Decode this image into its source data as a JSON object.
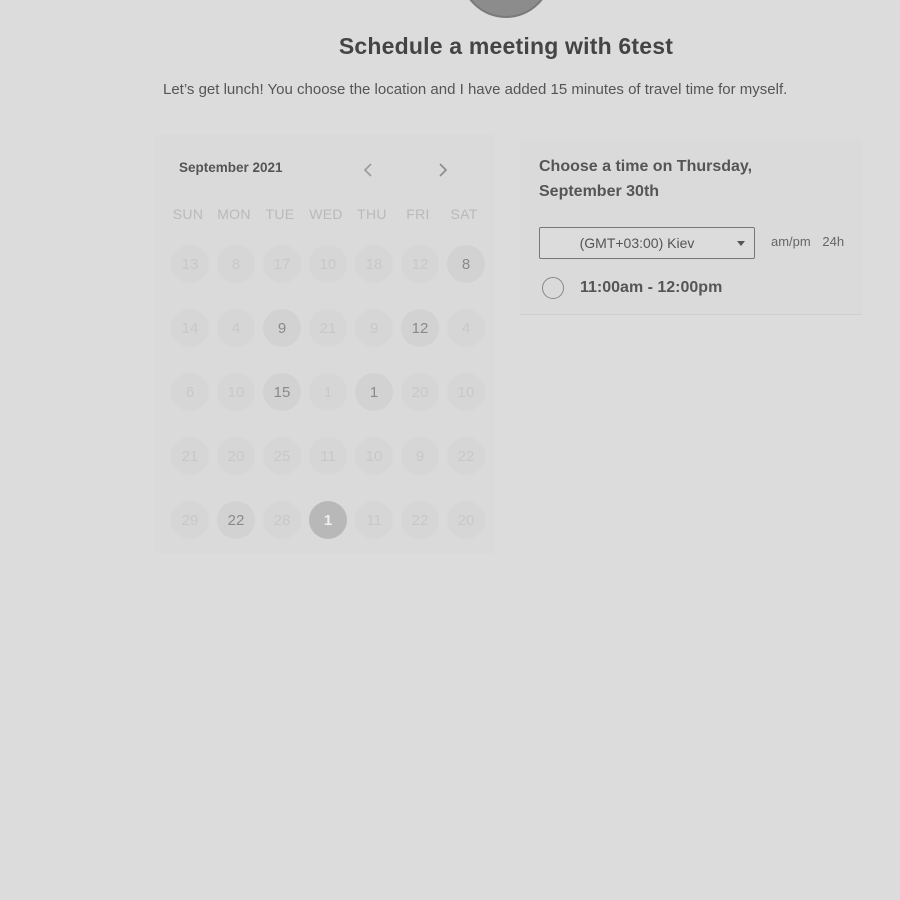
{
  "header": {
    "title": "Schedule a meeting with 6test",
    "subtitle": "Let’s get lunch! You choose the location and I have added 15 minutes of travel time for myself."
  },
  "calendar": {
    "month_label": "September 2021",
    "prev_icon": "chevron-left-icon",
    "next_icon": "chevron-right-icon",
    "weekdays": [
      "SUN",
      "MON",
      "TUE",
      "WED",
      "THU",
      "FRI",
      "SAT"
    ],
    "weeks": [
      [
        "13",
        "8",
        "17",
        "10",
        "18",
        "12",
        "8"
      ],
      [
        "14",
        "4",
        "9",
        "21",
        "9",
        "12",
        "4"
      ],
      [
        "6",
        "10",
        "15",
        "1",
        "1",
        "20",
        "10"
      ],
      [
        "21",
        "20",
        "25",
        "11",
        "10",
        "9",
        "22"
      ],
      [
        "29",
        "22",
        "28",
        "1",
        "11",
        "22",
        "20"
      ]
    ],
    "available_cells": [
      "0.6",
      "1.2",
      "1.5",
      "2.2",
      "2.4",
      "4.1"
    ],
    "selected_cell": "4.3"
  },
  "time_panel": {
    "heading": "Choose a time on Thursday, September 30th",
    "timezone": "(GMT+03:00) Kiev",
    "timezone_caret_icon": "caret-down-icon",
    "format_ampm": "am/pm",
    "format_24h": "24h",
    "slots": [
      {
        "label": "11:00am - 12:00pm"
      }
    ]
  },
  "colors": {
    "background": "#dcdcdc",
    "title_text": "#444444",
    "selected_day": "#b8b8b8",
    "border": "#777777"
  }
}
